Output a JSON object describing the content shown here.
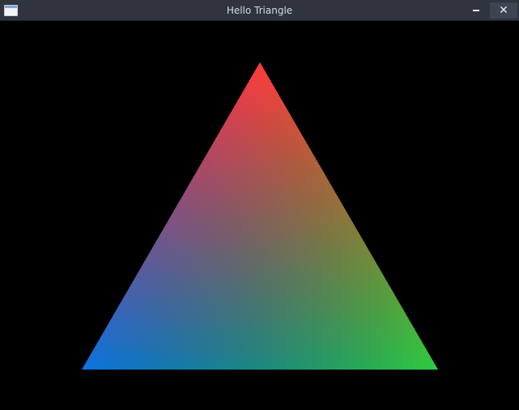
{
  "window": {
    "title": "Hello Triangle",
    "icon": "window-icon",
    "controls": {
      "minimize_icon": "minimize-icon",
      "close_icon": "close-icon",
      "close_glyph": "✕"
    }
  },
  "scene": {
    "background": "#000000",
    "triangle": {
      "vertex_colors": {
        "top": "#ff3b3b",
        "bottom_left": "#0a74e0",
        "bottom_right": "#2ecc40"
      }
    }
  }
}
